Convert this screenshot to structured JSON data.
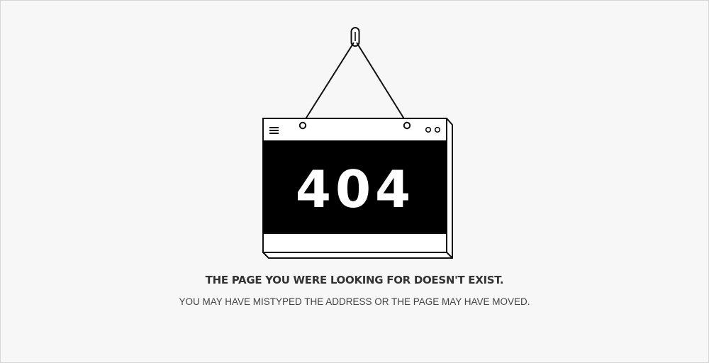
{
  "error_sign": {
    "code": "404"
  },
  "message": {
    "headline": "THE PAGE YOU WERE LOOKING FOR DOESN'T EXIST.",
    "subline": "YOU MAY HAVE MISTYPED THE ADDRESS OR THE PAGE MAY HAVE MOVED."
  },
  "colors": {
    "background": "#f6f7f6",
    "ink": "#111111",
    "panel": "#000000",
    "text": "#333333"
  },
  "icons": {
    "sign_menu": "hamburger-menu-icon",
    "sign_dots": "window-dots-icon",
    "hanger": "wall-hook-icon"
  }
}
